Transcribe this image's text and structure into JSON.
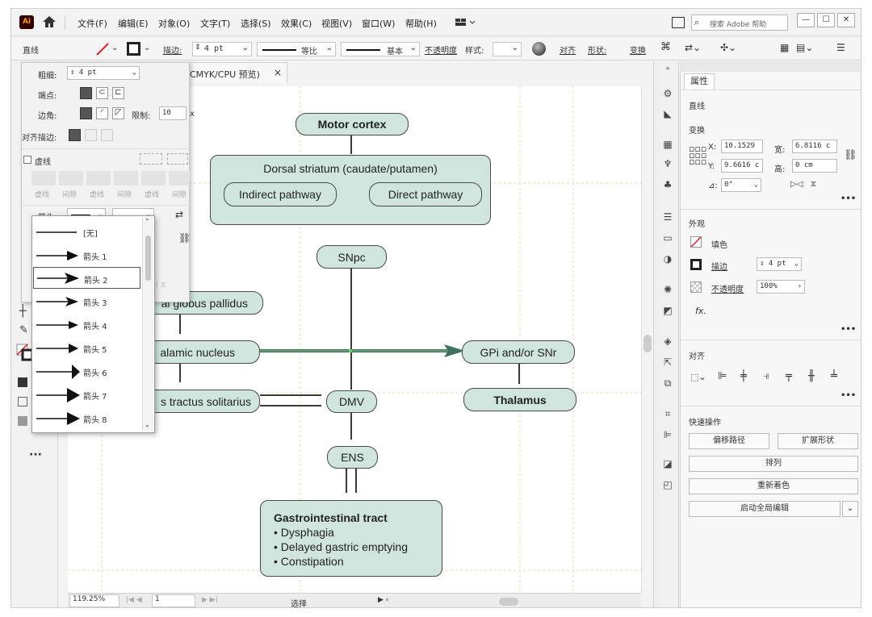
{
  "menubar": {
    "logo": "Ai",
    "items": [
      "文件(F)",
      "编辑(E)",
      "对象(O)",
      "文字(T)",
      "选择(S)",
      "效果(C)",
      "视图(V)",
      "窗口(W)",
      "帮助(H)"
    ],
    "search_placeholder": "搜索 Adobe 帮助"
  },
  "controlbar": {
    "object_type": "直线",
    "stroke_label": "描边:",
    "stroke_value": "4 pt",
    "profile_label": "等比",
    "brush_label": "基本",
    "opacity_label": "不透明度",
    "style_label": "样式:",
    "align_label": "对齐",
    "shape_label": "形状:",
    "transform_label": "变换"
  },
  "document_tab": {
    "title": "CMYK/CPU 预览)",
    "close": "×"
  },
  "stroke_panel": {
    "weight_label": "粗细:",
    "weight_value": "4 pt",
    "cap_label": "端点:",
    "corner_label": "边角:",
    "limit_label": "限制:",
    "limit_value": "10",
    "limit_unit": "x",
    "align_label": "对齐描边:",
    "dashed_label": "虚线",
    "dash_labels": [
      "虚线",
      "间隙",
      "虚线",
      "间隙",
      "虚线",
      "间隙"
    ],
    "arrow_label": "箭头:"
  },
  "arrow_list": {
    "items": [
      "[无]",
      "箭头 1",
      "箭头 2",
      "箭头 3",
      "箭头 4",
      "箭头 5",
      "箭头 6",
      "箭头 7",
      "箭头 8"
    ],
    "selected_index": 2
  },
  "diagram": {
    "motor_cortex": "Motor cortex",
    "dorsal_striatum": "Dorsal striatum (caudate/putamen)",
    "indirect": "Indirect pathway",
    "direct": "Direct pathway",
    "snpc": "SNpc",
    "globus_pallidus": "al globus pallidus",
    "thalamic": "alamic nucleus",
    "gpi": "GPi and/or SNr",
    "solitarius": "s tractus solitarius",
    "dmv": "DMV",
    "thalamus": "Thalamus",
    "ens": "ENS",
    "gi_title": "Gastrointestinal tract",
    "gi_items": [
      "• Dysphagia",
      "• Delayed gastric emptying",
      "• Constipation"
    ]
  },
  "statusbar": {
    "zoom": "119.25%",
    "page": "1",
    "tool": "选择"
  },
  "properties": {
    "tab": "属性",
    "object": "直线",
    "transform_title": "变换",
    "x_label": "X:",
    "x_value": "10.1529",
    "y_label": "Y:",
    "y_value": "9.6616 c",
    "w_label": "宽:",
    "w_value": "6.8116 c",
    "h_label": "高:",
    "h_value": "0 cm",
    "angle_label": "⊿:",
    "angle_value": "0°",
    "appearance_title": "外观",
    "fill_label": "填色",
    "stroke_label": "描边",
    "stroke_value": "4 pt",
    "opacity_label": "不透明度",
    "opacity_value": "100%",
    "fx_label": "fx.",
    "align_title": "对齐",
    "quick_title": "快速操作",
    "offset_path": "偏移路径",
    "expand_shape": "扩展形状",
    "arrange": "排列",
    "recolor": "重新着色",
    "global_edit": "启动全局编辑"
  },
  "colors": {
    "node_fill": "#cfe5de",
    "highlight_line": "#3f6f5f",
    "selection_green": "#6ad26a"
  }
}
